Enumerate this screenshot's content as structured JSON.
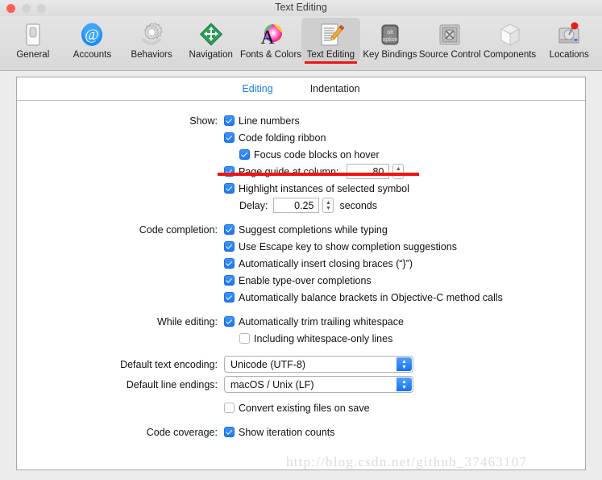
{
  "window": {
    "title": "Text Editing",
    "traffic_lights": [
      "close",
      "minimize",
      "zoom"
    ]
  },
  "toolbar": {
    "items": [
      {
        "label": "General",
        "icon": "general-switch-icon",
        "selected": false
      },
      {
        "label": "Accounts",
        "icon": "at-sign-icon",
        "selected": false
      },
      {
        "label": "Behaviors",
        "icon": "gear-icon",
        "selected": false
      },
      {
        "label": "Navigation",
        "icon": "navigation-arrows-icon",
        "selected": false
      },
      {
        "label": "Fonts & Colors",
        "icon": "font-color-wheel-icon",
        "selected": false
      },
      {
        "label": "Text Editing",
        "icon": "document-pencil-icon",
        "selected": true
      },
      {
        "label": "Key Bindings",
        "icon": "option-key-icon",
        "selected": false
      },
      {
        "label": "Source Control",
        "icon": "safe-vault-icon",
        "selected": false
      },
      {
        "label": "Components",
        "icon": "cube-icon",
        "selected": false
      },
      {
        "label": "Locations",
        "icon": "hard-drive-pin-icon",
        "selected": false
      }
    ]
  },
  "tabs": [
    {
      "label": "Editing",
      "active": true
    },
    {
      "label": "Indentation",
      "active": false
    }
  ],
  "sections": {
    "show": {
      "label": "Show:",
      "line_numbers": {
        "label": "Line numbers",
        "checked": true
      },
      "code_folding": {
        "label": "Code folding ribbon",
        "checked": true
      },
      "focus_blocks": {
        "label": "Focus code blocks on hover",
        "checked": true
      },
      "page_guide": {
        "label": "Page guide at column:",
        "checked": true,
        "value": "80"
      },
      "highlight_instances": {
        "label": "Highlight instances of selected symbol",
        "checked": true
      },
      "delay": {
        "label": "Delay:",
        "value": "0.25",
        "unit": "seconds"
      }
    },
    "code_completion": {
      "label": "Code completion:",
      "items": [
        {
          "label": "Suggest completions while typing",
          "checked": true
        },
        {
          "label": "Use Escape key to show completion suggestions",
          "checked": true
        },
        {
          "label": "Automatically insert closing braces (“}”)",
          "checked": true
        },
        {
          "label": "Enable type-over completions",
          "checked": true
        },
        {
          "label": "Automatically balance brackets in Objective-C method calls",
          "checked": true
        }
      ]
    },
    "while_editing": {
      "label": "While editing:",
      "items": [
        {
          "label": "Automatically trim trailing whitespace",
          "checked": true
        },
        {
          "label": "Including whitespace-only lines",
          "checked": false
        }
      ]
    },
    "text_encoding": {
      "label": "Default text encoding:",
      "value": "Unicode (UTF-8)"
    },
    "line_endings": {
      "label": "Default line endings:",
      "value": "macOS / Unix (LF)"
    },
    "convert_files": {
      "label": "Convert existing files on save",
      "checked": false
    },
    "code_coverage": {
      "label": "Code coverage:",
      "items": [
        {
          "label": "Show iteration counts",
          "checked": true
        }
      ]
    }
  },
  "annotation": {
    "color": "#f01414",
    "targets": [
      "toolbar-item-text-editing",
      "page-guide-row"
    ]
  },
  "watermark": {
    "text": "http://blog.csdn.net/github_37463107"
  }
}
